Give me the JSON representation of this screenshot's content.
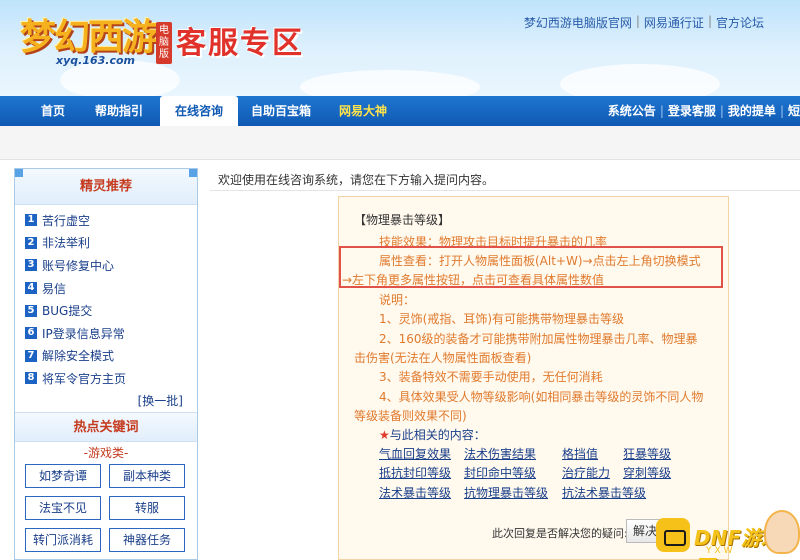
{
  "header": {
    "logo_text": "梦幻西游",
    "logo_badge": "电脑版",
    "logo_url": "xyq.163.com",
    "zone_title": "客服专区",
    "top_links": [
      "梦幻西游电脑版官网",
      "网易通行证",
      "官方论坛"
    ]
  },
  "nav": {
    "items": [
      "首页",
      "帮助指引",
      "在线咨询",
      "自助百宝箱",
      "网易大神"
    ],
    "active": "在线咨询",
    "right_links": [
      "系统公告",
      "登录客服",
      "我的提单",
      "短"
    ]
  },
  "sidebar": {
    "rec_title": "精灵推荐",
    "rec_items": [
      {
        "num": "1",
        "label": "苦行虚空"
      },
      {
        "num": "2",
        "label": "非法举利"
      },
      {
        "num": "3",
        "label": "账号修复中心"
      },
      {
        "num": "4",
        "label": "易信"
      },
      {
        "num": "5",
        "label": "BUG提交"
      },
      {
        "num": "6",
        "label": "IP登录信息异常"
      },
      {
        "num": "7",
        "label": "解除安全模式"
      },
      {
        "num": "8",
        "label": "将军令官方主页"
      }
    ],
    "more": "[换一批]",
    "hot_title": "热点关键词",
    "game_cat": "-游戏类-",
    "keywords": [
      "如梦奇谭",
      "副本种类",
      "法宝不见",
      "转服",
      "转门派消耗",
      "神器任务"
    ]
  },
  "main": {
    "welcome": "欢迎使用在线咨询系统，请您在下方输入提问内容。",
    "answer": {
      "title": "【物理暴击等级】",
      "effect": "技能效果：物理攻击目标时提升暴击的几率",
      "view1": "属性查看：打开人物属性面板(Alt+W)→点击左上角切换模式",
      "view2": "→左下角更多属性按钮，点击可查看具体属性数值",
      "note": "说明：",
      "n1": "1、灵饰(戒指、耳饰)有可能携带物理暴击等级",
      "n2a": "2、160级的装备才可能携带附加属性物理暴击几率、物理暴",
      "n2b": "击伤害(无法在人物属性面板查看)",
      "n3": "3、装备特效不需要手动使用，无任何消耗",
      "n4a": "4、具体效果受人物等级影响(如相同暴击等级的灵饰不同人物",
      "n4b": "等级装备则效果不同)",
      "related_star": "★",
      "related_title": "与此相关的内容：",
      "related": [
        [
          "气血回复效果",
          "法术伤害结果",
          "格挡值",
          "狂暴等级"
        ],
        [
          "抵抗封印等级",
          "封印命中等级",
          "治疗能力",
          "穿刺等级"
        ],
        [
          "法术暴击等级",
          "抗物理暴击等级",
          "抗法术暴击等级"
        ]
      ]
    },
    "solved_text": "此次回复是否解决您的疑问:",
    "solved_button": "解决"
  },
  "watermark": {
    "text": "DNF游戏网",
    "sub": "YXW"
  }
}
